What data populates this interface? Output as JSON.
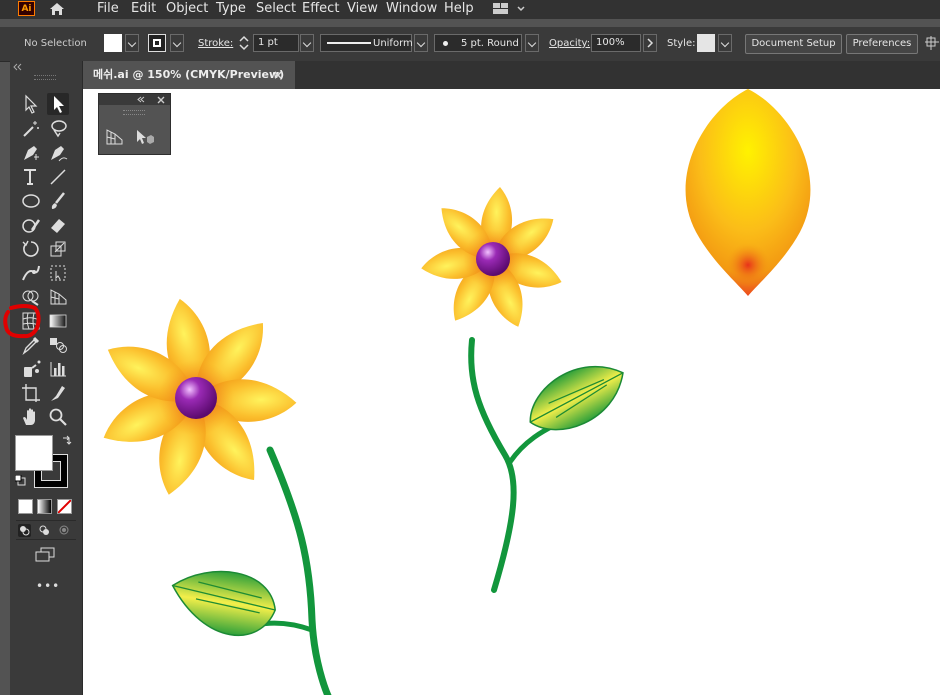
{
  "app": {
    "logo_text": "Ai"
  },
  "menu": [
    "File",
    "Edit",
    "Object",
    "Type",
    "Select",
    "Effect",
    "View",
    "Window",
    "Help"
  ],
  "control_bar": {
    "selection_label": "No Selection",
    "stroke_label": "Stroke:",
    "stroke_weight": "1 pt",
    "stroke_style": "Uniform",
    "brush": "5 pt. Round",
    "opacity_label": "Opacity:",
    "opacity_value": "100%",
    "style_label": "Style:",
    "document_setup": "Document Setup",
    "preferences": "Preferences"
  },
  "document_tab": {
    "title": "메쉬.ai @ 150% (CMYK/Preview)",
    "close": "×"
  },
  "colors": {
    "accent_orange": "#f6a21c",
    "stem_green": "#12963c",
    "highlight_red": "#e00000"
  },
  "toolbar": {
    "tools": [
      "direct-selection",
      "selection",
      "magic-wand",
      "lasso",
      "pen",
      "curvature",
      "type",
      "line-segment",
      "ellipse",
      "paintbrush",
      "shaper",
      "eraser",
      "rotate",
      "scale",
      "puppet-warp",
      "free-transform",
      "shape-builder",
      "perspective-grid",
      "mesh",
      "gradient",
      "eyedropper",
      "blend",
      "symbol-sprayer",
      "column-graph",
      "artboard",
      "slice",
      "hand",
      "zoom"
    ],
    "more": "•••"
  }
}
